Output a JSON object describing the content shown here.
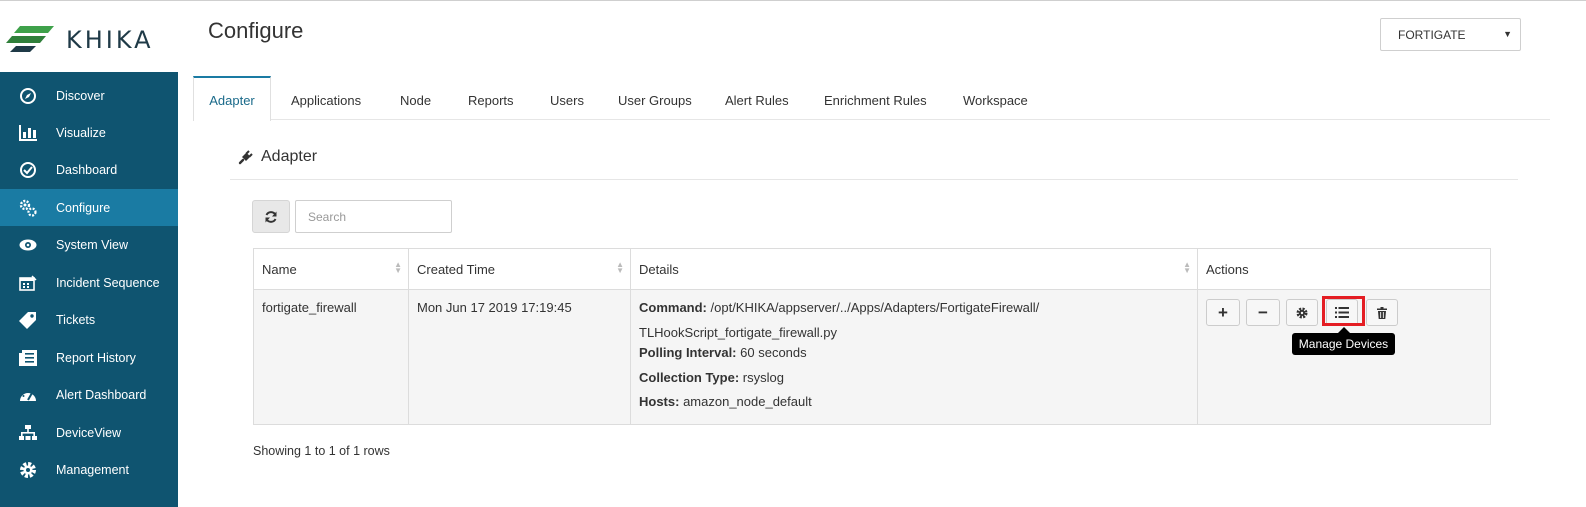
{
  "app": {
    "brand": "KHIKA",
    "page_title": "Configure"
  },
  "selector": {
    "value": "FORTIGATE"
  },
  "sidebar": {
    "items": [
      {
        "label": "Discover",
        "icon": "compass-icon"
      },
      {
        "label": "Visualize",
        "icon": "bar-chart-icon"
      },
      {
        "label": "Dashboard",
        "icon": "gauge-icon"
      },
      {
        "label": "Configure",
        "icon": "gears-icon",
        "active": true
      },
      {
        "label": "System View",
        "icon": "eye-icon"
      },
      {
        "label": "Incident Sequence",
        "icon": "calendar-icon"
      },
      {
        "label": "Tickets",
        "icon": "tag-icon"
      },
      {
        "label": "Report History",
        "icon": "report-icon"
      },
      {
        "label": "Alert Dashboard",
        "icon": "dashboard-icon"
      },
      {
        "label": "DeviceView",
        "icon": "sitemap-icon"
      },
      {
        "label": "Management",
        "icon": "gear-icon"
      }
    ]
  },
  "tabs": [
    {
      "label": "Adapter",
      "active": true
    },
    {
      "label": "Applications"
    },
    {
      "label": "Node"
    },
    {
      "label": "Reports"
    },
    {
      "label": "Users"
    },
    {
      "label": "User Groups"
    },
    {
      "label": "Alert Rules"
    },
    {
      "label": "Enrichment Rules"
    },
    {
      "label": "Workspace"
    }
  ],
  "section": {
    "title": "Adapter",
    "icon": "plug-icon"
  },
  "search": {
    "placeholder": "Search"
  },
  "table": {
    "headers": [
      "Name",
      "Created Time",
      "Details",
      "Actions"
    ],
    "rows": [
      {
        "name": "fortigate_firewall",
        "created": "Mon Jun 17 2019 17:19:45",
        "details": {
          "command_label": "Command:",
          "command_line1": "/opt/KHIKA/appserver/../Apps/Adapters/FortigateFirewall/",
          "command_line2": "TLHookScript_fortigate_firewall.py",
          "polling_label": "Polling Interval:",
          "polling_value": "60 seconds",
          "collection_label": "Collection Type:",
          "collection_value": "rsyslog",
          "hosts_label": "Hosts:",
          "hosts_value": "amazon_node_default"
        },
        "actions": [
          {
            "name": "add",
            "glyph": "+"
          },
          {
            "name": "remove",
            "glyph": "−"
          },
          {
            "name": "settings",
            "icon": "gear-icon"
          },
          {
            "name": "manage-devices",
            "icon": "list-icon"
          },
          {
            "name": "delete",
            "icon": "trash-icon"
          }
        ]
      }
    ]
  },
  "tooltip": {
    "text": "Manage Devices"
  },
  "footer": {
    "pagination_text": "Showing 1 to 1 of 1 rows"
  },
  "colors": {
    "sidebar": "#0f5470",
    "sidebar_active": "#1a7ba3",
    "highlight": "#e41d23",
    "logo_green": "#3ea14a"
  }
}
